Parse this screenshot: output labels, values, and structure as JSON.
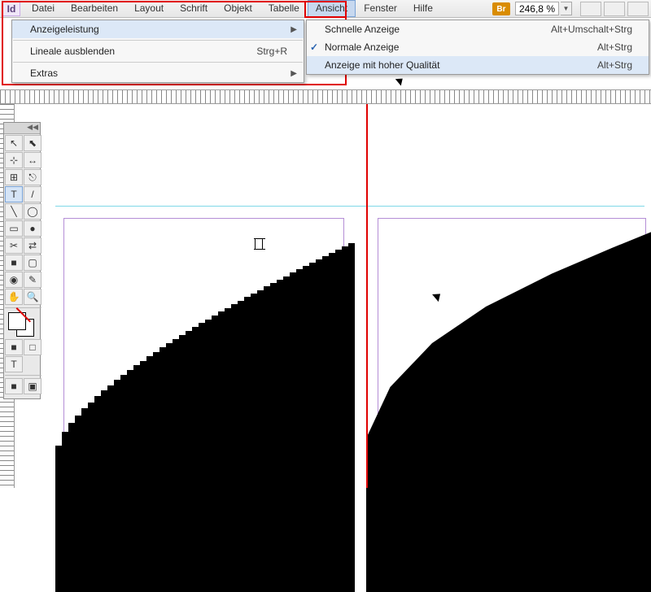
{
  "app_icon": "Id",
  "menubar": [
    "Datei",
    "Bearbeiten",
    "Layout",
    "Schrift",
    "Objekt",
    "Tabelle",
    "Ansicht",
    "Fenster",
    "Hilfe"
  ],
  "active_menu_index": 6,
  "br_badge": "Br",
  "zoom": "246,8 %",
  "dropdown_left": {
    "items": [
      {
        "label": "Anzeigeleistung",
        "hasSubmenu": true
      },
      {
        "label": "Lineale ausblenden",
        "shortcut": "Strg+R"
      },
      {
        "label": "Extras",
        "hasSubmenu": true
      }
    ]
  },
  "dropdown_right": {
    "items": [
      {
        "label": "Schnelle Anzeige",
        "shortcut": "Alt+Umschalt+Strg"
      },
      {
        "label": "Normale Anzeige",
        "shortcut": "Alt+Strg",
        "checked": true
      },
      {
        "label": "Anzeige mit hoher Qualität",
        "shortcut": "Alt+Strg",
        "hover": true
      }
    ]
  },
  "tools": [
    "↖",
    "⬉",
    "⊹",
    "↔",
    "⊞",
    "⎋",
    "T",
    "/",
    "╲",
    "◯",
    "▭",
    "●",
    "✂",
    "⇄",
    "■",
    "▢",
    "◉",
    "✎",
    "✋",
    "🔍"
  ],
  "swatch_mode_icons": [
    "■",
    "□",
    "T"
  ],
  "view_mode_icons": [
    "■",
    "▣"
  ]
}
